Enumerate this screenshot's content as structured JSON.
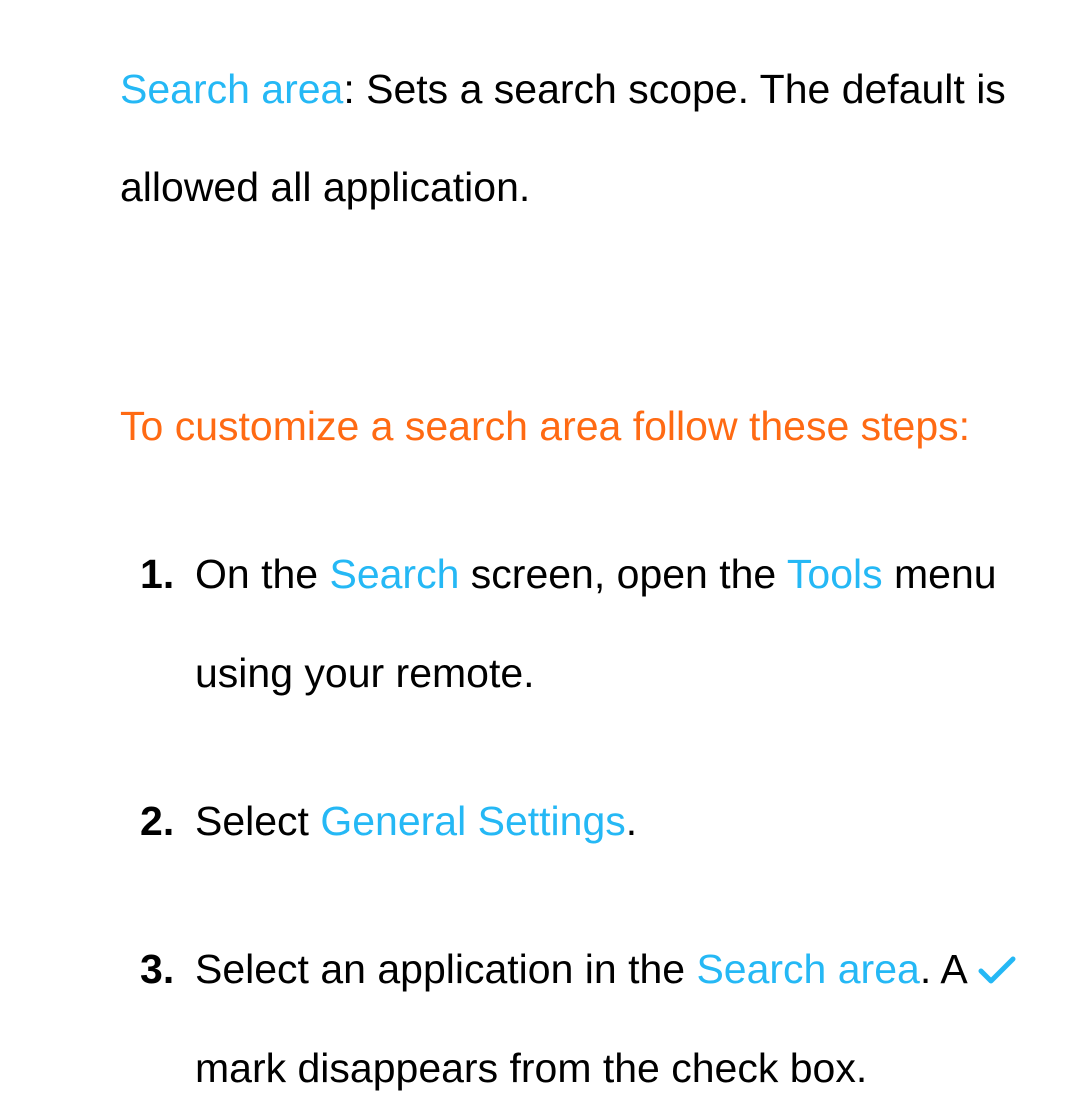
{
  "intro": {
    "term": "Search area",
    "desc_after": ": Sets a search scope. The default is allowed all application."
  },
  "heading": "To customize a search area follow these steps:",
  "steps": {
    "s1": {
      "a": "On the ",
      "b": "Search",
      "c": " screen, open the ",
      "d": "Tools",
      "e": " menu using your remote."
    },
    "s2": {
      "a": "Select ",
      "b": "General Settings",
      "c": "."
    },
    "s3": {
      "a": "Select an application in the ",
      "b": "Search area",
      "c": ". A ",
      "d": " mark disappears from the check box."
    }
  }
}
